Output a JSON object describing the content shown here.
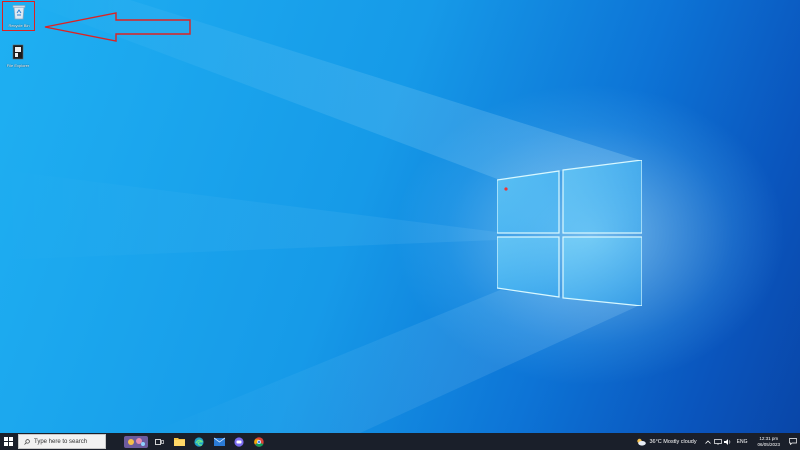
{
  "desktop": {
    "icons": [
      {
        "name": "recycle-bin-icon",
        "label": "Recycle Bin"
      },
      {
        "name": "file-explorer-shortcut-icon",
        "label": "File Explorer"
      }
    ],
    "annotation_color": "#d22"
  },
  "taskbar": {
    "search_placeholder": "Type here to search",
    "weather_text": "36°C  Mostly cloudy",
    "language": "ENG",
    "time": "12:31 pm",
    "date": "06/05/2023"
  },
  "colors": {
    "taskbar_bg": "#1a1f2a",
    "wallpaper_blue": "#169ae8",
    "wallpaper_dark": "#0946a8"
  }
}
